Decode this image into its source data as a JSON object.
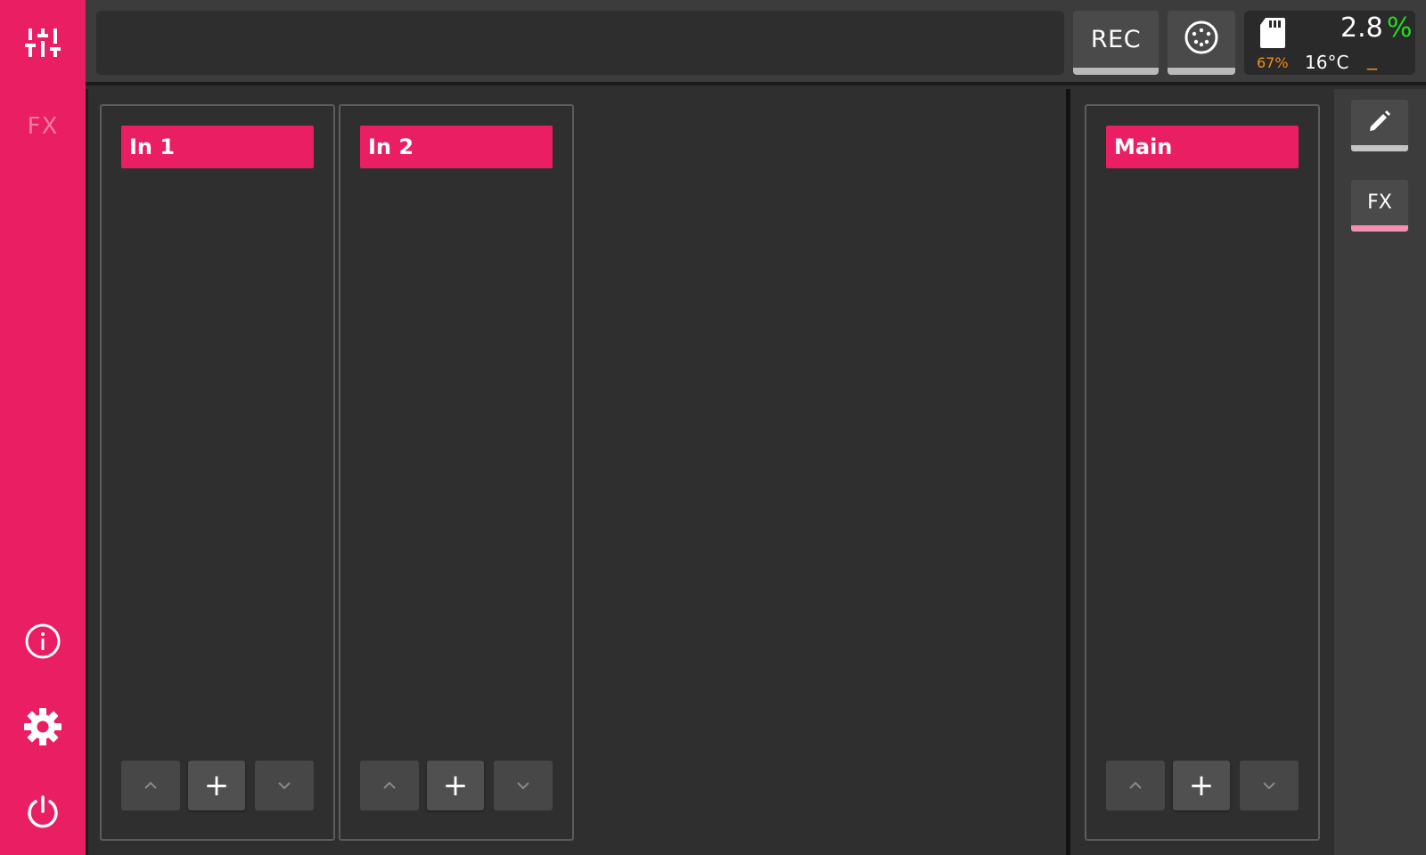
{
  "sidebar": {
    "items": [
      {
        "name": "mixer",
        "icon": "sliders-icon"
      },
      {
        "name": "fx",
        "label": "FX"
      },
      {
        "name": "info",
        "icon": "info-icon"
      },
      {
        "name": "settings",
        "icon": "gear-icon"
      },
      {
        "name": "power",
        "icon": "power-icon"
      }
    ]
  },
  "topbar": {
    "message": "",
    "rec_label": "REC",
    "midi_icon": "midi-connector-icon",
    "status": {
      "storage_icon": "sd-card-icon",
      "storage_percent": "67%",
      "cpu_value": "2.8",
      "cpu_unit": "%",
      "temperature": "16°C",
      "indicator": "_"
    }
  },
  "strips": [
    {
      "title": "In 1"
    },
    {
      "title": "In 2"
    }
  ],
  "main_strip": {
    "title": "Main"
  },
  "strip_controls": {
    "add_label": "+",
    "up_icon": "chevron-up-icon",
    "down_icon": "chevron-down-icon"
  },
  "right_toolbar": {
    "edit_icon": "pencil-icon",
    "fx_label": "FX"
  },
  "colors": {
    "accent": "#e91e63",
    "cpu_unit": "#22dd22",
    "storage": "#f28c1a",
    "indicator": "#f28c1a",
    "fx_underline": "#f28fb2"
  }
}
